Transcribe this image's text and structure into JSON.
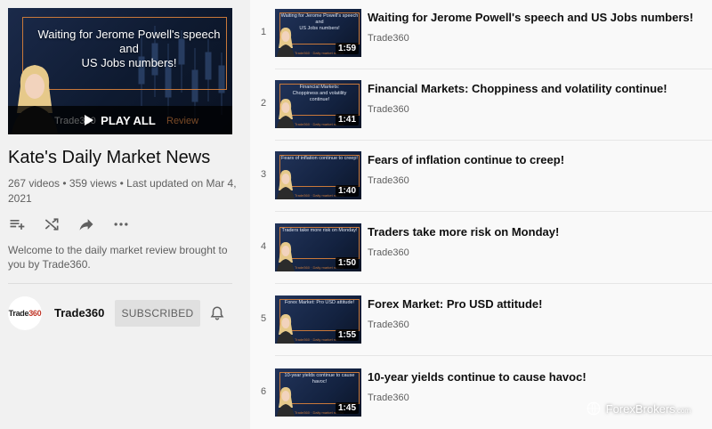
{
  "playlist": {
    "hero_title": "Waiting for Jerome Powell's speech\nand\nUS Jobs numbers!",
    "play_all_label": "PLAY ALL",
    "hero_brand_ghost": "Trade360",
    "hero_review_ghost": "Review",
    "title": "Kate's Daily Market News",
    "stats": "267 videos • 359 views • Last updated on Mar 4, 2021",
    "description": "Welcome to the daily market review brought to you by Trade360.",
    "actions": {
      "save_icon": "playlist-add-icon",
      "shuffle_icon": "shuffle-icon",
      "share_icon": "share-icon",
      "more_icon": "more-horiz-icon"
    }
  },
  "owner": {
    "avatar_text_a": "Trade",
    "avatar_text_b": "360",
    "name": "Trade360",
    "subscribe_label": "SUBSCRIBED",
    "bell_icon": "bell-icon"
  },
  "videos": [
    {
      "index": "1",
      "title": "Waiting for Jerome Powell's speech and US Jobs numbers!",
      "channel": "Trade360",
      "duration": "1:59",
      "thumb_caption": "Waiting for Jerome Powell's speech\nand\nUS Jobs numbers!"
    },
    {
      "index": "2",
      "title": "Financial Markets: Choppiness and volatility continue!",
      "channel": "Trade360",
      "duration": "1:41",
      "thumb_caption": "Financial Markets:\nChoppiness and volatility\ncontinue!"
    },
    {
      "index": "3",
      "title": "Fears of inflation continue to creep!",
      "channel": "Trade360",
      "duration": "1:40",
      "thumb_caption": "Fears of inflation continue to creep!"
    },
    {
      "index": "4",
      "title": "Traders take more risk on Monday!",
      "channel": "Trade360",
      "duration": "1:50",
      "thumb_caption": "Traders take more risk on Monday!"
    },
    {
      "index": "5",
      "title": "Forex Market: Pro USD attitude!",
      "channel": "Trade360",
      "duration": "1:55",
      "thumb_caption": "Forex Market: Pro USD attitude!"
    },
    {
      "index": "6",
      "title": "10-year yields continue to cause havoc!",
      "channel": "Trade360",
      "duration": "1:45",
      "thumb_caption": "10-year yields continue to cause havoc!"
    }
  ],
  "thumb_brand": "Trade360 · Daily market review",
  "watermark": {
    "text": "ForexBrokers",
    "suffix": ".com",
    "icon": "globe-logo-icon"
  },
  "colors": {
    "accent_orange": "#c8783a",
    "navy": "#132240",
    "muted_text": "#606060"
  }
}
